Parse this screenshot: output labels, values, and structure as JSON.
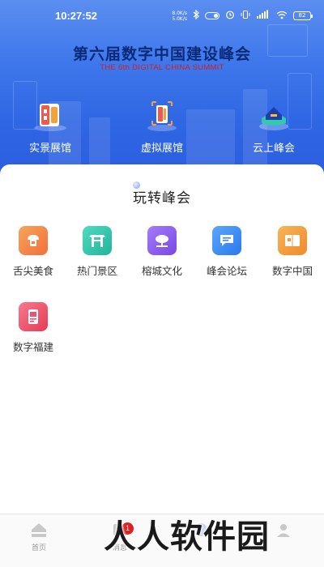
{
  "status_bar": {
    "time": "10:27:52",
    "net_speed_up": "8.0K/s",
    "net_speed_down": "5.0K/s",
    "battery": "82",
    "icons": [
      "bluetooth-icon",
      "toggle-icon",
      "alarm-icon",
      "vibrate-icon",
      "signal-icon",
      "wifi-icon",
      "battery-icon"
    ]
  },
  "header": {
    "title": "第六届数字中国建设峰会",
    "subtitle": "THE 6th DIGITAL CHINA SUMMIT",
    "halls": [
      {
        "label": "实景展馆",
        "icon": "real-exhibition-icon"
      },
      {
        "label": "虚拟展馆",
        "icon": "virtual-exhibition-icon"
      },
      {
        "label": "云上峰会",
        "icon": "cloud-summit-icon"
      }
    ]
  },
  "section": {
    "title": "玩转峰会",
    "items": [
      {
        "label": "舌尖美食",
        "icon": "food-icon",
        "color": "#f5894a"
      },
      {
        "label": "热门景区",
        "icon": "scenic-gate-icon",
        "color": "#2fc4a8"
      },
      {
        "label": "榕城文化",
        "icon": "banyan-tree-icon",
        "color": "#8a5cf0"
      },
      {
        "label": "峰会论坛",
        "icon": "forum-chat-icon",
        "color": "#3a8ef5"
      },
      {
        "label": "数字中国",
        "icon": "digital-china-book-icon",
        "color": "#f39a3a"
      },
      {
        "label": "数字福建",
        "icon": "digital-fujian-icon",
        "color": "#f0506a"
      }
    ]
  },
  "bottom_nav": {
    "items": [
      {
        "label": "首页",
        "icon": "home-icon"
      },
      {
        "label": "消息",
        "icon": "message-icon",
        "badge": "1"
      },
      {
        "label": "",
        "icon": "service-icon"
      },
      {
        "label": "",
        "icon": "profile-icon"
      }
    ]
  },
  "watermark": "人人软件园"
}
